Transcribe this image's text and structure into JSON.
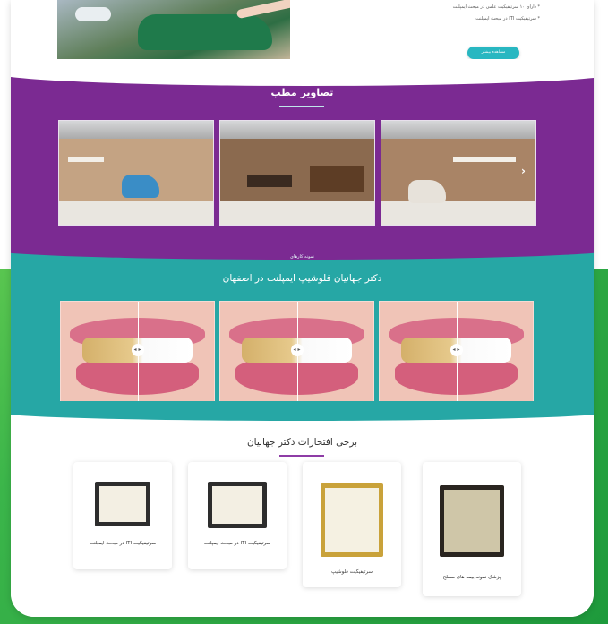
{
  "top": {
    "list": [
      "* دارای ۱۰ سرتیفیکیت علمی در مبحث ایمپلنت",
      "* سرتیفیکیت ITI در مبحث ایمپلنت"
    ],
    "button_label": "مشاهده بیشتر"
  },
  "gallery": {
    "title": "تصاویر مطب",
    "next_icon": "chevron-right-icon"
  },
  "smiles": {
    "subtitle": "نمونه کارهای",
    "title": "دکتر جهانیان فلوشیپ ایمپلنت در اصفهان",
    "knob_label": "◂ ▸"
  },
  "awards": {
    "title": "برخی افتخارات دکتر جهانیان",
    "items": [
      {
        "label": "سرتیفیکیت ITI در مبحث ایمپلنت"
      },
      {
        "label": "سرتیفیکیت ITI در مبحث ایمپلنت"
      },
      {
        "label": "سرتیفیکیت فلوشیپ"
      },
      {
        "label": "پزشک نمونه بیمه های مسلح"
      }
    ]
  },
  "colors": {
    "purple": "#7b2a92",
    "teal": "#26a7a5",
    "green": "#3bb54a"
  }
}
